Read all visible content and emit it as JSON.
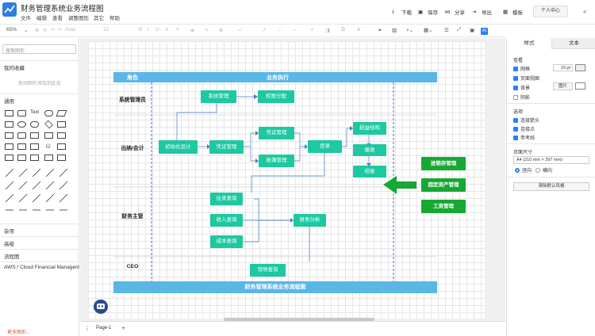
{
  "app": {
    "title": "财务管理系统业务流程图",
    "menu": [
      "文件",
      "编辑",
      "查看",
      "调整图形",
      "其它",
      "帮助"
    ]
  },
  "topbar": {
    "buttons": [
      "下载",
      "保存",
      "分享",
      "导出",
      "模板"
    ],
    "user": "个人中心"
  },
  "toolbar": {
    "zoom": "65%",
    "font": "Arial",
    "font_size": "12"
  },
  "leftpanel": {
    "search_placeholder": "搜索图形",
    "favorites": "我的收藏",
    "favorites_hint": "拖动图形添加到此处",
    "general": "通用",
    "sections": [
      "杂项",
      "高级",
      "流程图",
      "AWS / Cloud Financial Managem"
    ],
    "more": "更多图形..."
  },
  "rightpanel": {
    "tabs": [
      "样式",
      "文本"
    ],
    "view_label": "查看",
    "checks": [
      {
        "label": "网格",
        "on": true
      },
      {
        "label": "页面视图",
        "on": true
      },
      {
        "label": "背景",
        "on": true
      },
      {
        "label": "阴影",
        "on": false
      }
    ],
    "grid_size": "10 pt",
    "bg_button": "图片",
    "options_label": "选项",
    "options": [
      {
        "label": "连接箭头",
        "on": true
      },
      {
        "label": "连接点",
        "on": true
      },
      {
        "label": "参考线",
        "on": true
      }
    ],
    "paper_label": "页面尺寸",
    "paper_value": "A4 (210 mm × 297 mm)",
    "orientation": [
      "竖向",
      "横向"
    ],
    "reset_button": "清除默认风格"
  },
  "pagebar": {
    "page": "Page-1"
  },
  "diagram": {
    "header_role": "角色",
    "header_exec": "业务执行",
    "footer": "财务管理系统业务流程图",
    "roles": [
      "系统管理员",
      "出纳/会计",
      "财务主管",
      "CEO"
    ],
    "nodes": {
      "sys": "系统管理",
      "perm": "权限分配",
      "init": "初始化设计",
      "voucher": "凭证管理",
      "vcheck": "凭证管理",
      "ledger": "账簿管理",
      "login": "登录",
      "pl": "损益结构",
      "report": "报表",
      "settle": "结账",
      "acct": "往来查询",
      "income": "收入查询",
      "cost": "成本查询",
      "analysis": "财务分析",
      "leader": "领导查询"
    },
    "green": [
      "进销存管理",
      "固定资产管理",
      "工资管理"
    ]
  }
}
